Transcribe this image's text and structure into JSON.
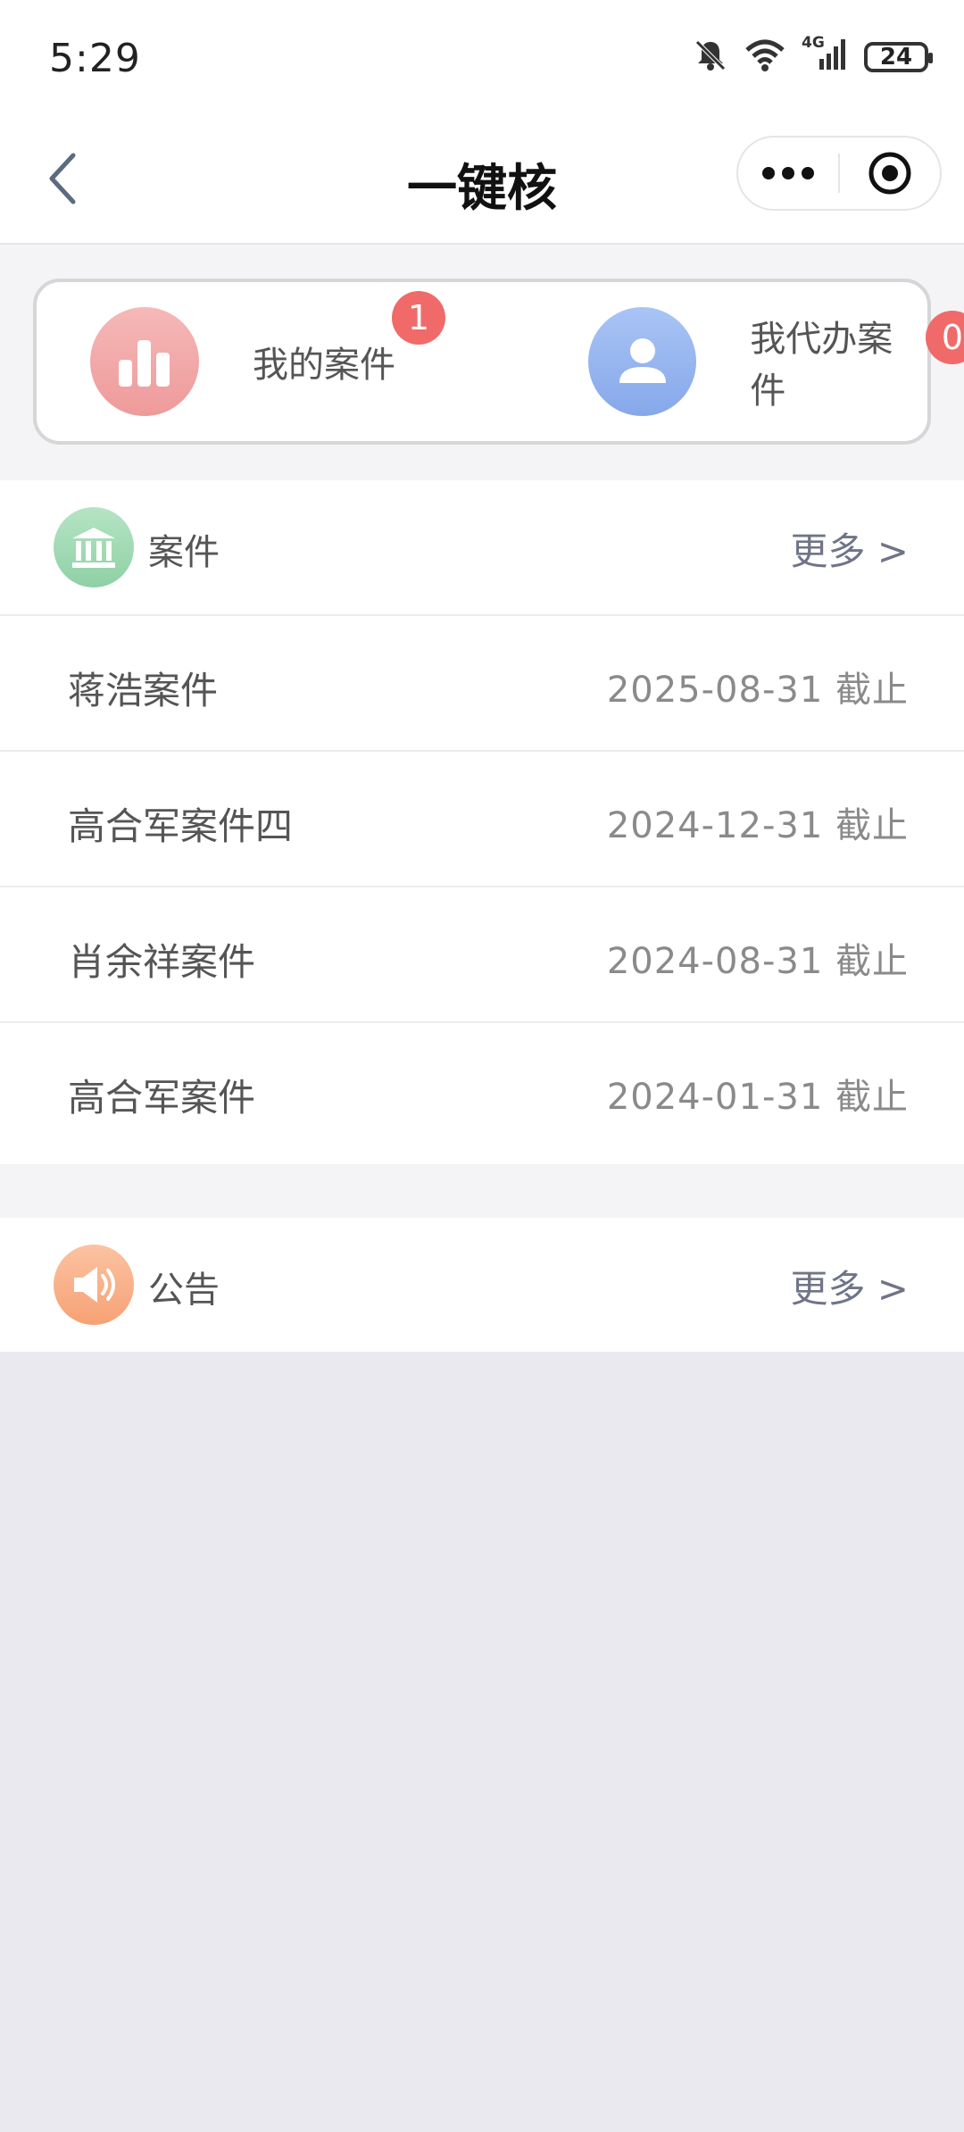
{
  "status_bar": {
    "time": "5:29",
    "network": "4G",
    "battery": "24",
    "icons": [
      "bell-off-icon",
      "wifi-icon",
      "signal-icon",
      "battery-icon"
    ]
  },
  "navbar": {
    "title": "一键核",
    "back_icon": "chevron-left-icon",
    "more_icon": "more-dots-icon",
    "target_icon": "target-icon"
  },
  "quick_actions": [
    {
      "label": "我的案件",
      "badge": "1",
      "icon": "bar-chart-icon",
      "color": "#f2a2a2"
    },
    {
      "label": "我代办案件",
      "badge": "0",
      "icon": "user-icon",
      "color": "#93b3f0"
    }
  ],
  "cases_panel": {
    "title": "案件",
    "more": "更多 >",
    "icon": "bank-icon",
    "icon_color": "#9fd8b4",
    "items": [
      {
        "name": "蒋浩案件",
        "deadline": "2025-08-31 截止"
      },
      {
        "name": "高合军案件四",
        "deadline": "2024-12-31 截止"
      },
      {
        "name": "肖余祥案件",
        "deadline": "2024-08-31 截止"
      },
      {
        "name": "高合军案件",
        "deadline": "2024-01-31 截止"
      }
    ]
  },
  "notice_panel": {
    "title": "公告",
    "more": "更多 >",
    "icon": "speaker-icon",
    "icon_color": "#f9b08a"
  }
}
